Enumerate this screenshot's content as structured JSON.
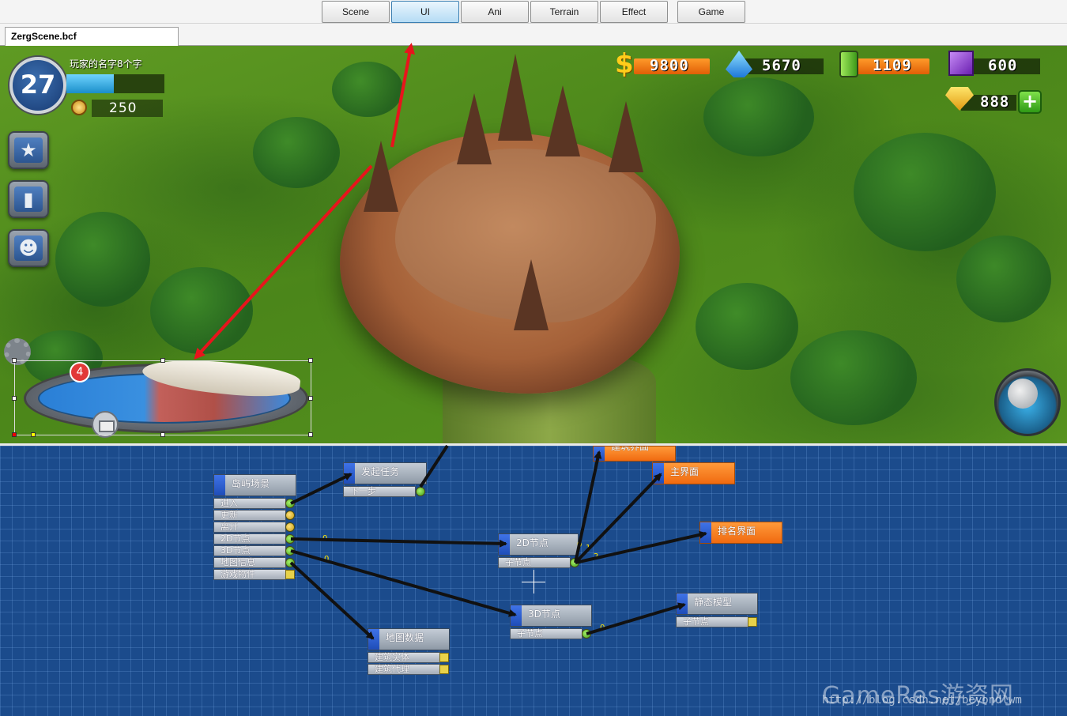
{
  "mode_tabs": [
    {
      "label": "Scene",
      "active": false
    },
    {
      "label": "UI",
      "active": true
    },
    {
      "label": "Ani",
      "active": false
    },
    {
      "label": "Terrain",
      "active": false
    },
    {
      "label": "Effect",
      "active": false
    },
    {
      "label": "Game",
      "active": false
    }
  ],
  "document_tab": {
    "label": "ZergScene.bcf"
  },
  "hud": {
    "level": "27",
    "player_name": "玩家的名字8个字",
    "xp_progress": 0.48,
    "medal_value": "250",
    "resources": {
      "gold": "9800",
      "crystal": "5670",
      "energy": "1109",
      "cube": "600",
      "gem": "888"
    },
    "plus_label": "+",
    "badge_count": "4"
  },
  "editor": {
    "nodes": {
      "island_scene": {
        "title": "岛屿场景",
        "ports": [
          "进入",
          "更新",
          "离开",
          "2D节点",
          "3D节点",
          "地图信息",
          "游戏物件"
        ]
      },
      "start_task": {
        "title": "发起任务",
        "ports": [
          "下一步"
        ]
      },
      "build_ui": {
        "title": "建筑界面"
      },
      "main_ui": {
        "title": "主界面"
      },
      "rank_ui": {
        "title": "排名界面"
      },
      "node_2d": {
        "title": "2D节点",
        "ports": [
          "子节点"
        ]
      },
      "node_3d": {
        "title": "3D节点",
        "ports": [
          "子节点"
        ]
      },
      "static_model": {
        "title": "静态模型",
        "ports": [
          "子节点"
        ]
      },
      "map_data": {
        "title": "地图数据",
        "ports": [
          "建筑实体",
          "建筑代理"
        ]
      }
    },
    "wire_labels": [
      "0",
      "0",
      "0",
      "1",
      "2",
      "0"
    ]
  },
  "watermark": {
    "brand": "GameRes游资网",
    "url": "http://blog.csdn.net/beyondlwm"
  },
  "colors": {
    "accent_tab": "#b5dcf5",
    "grid_bg": "#1b4b8c",
    "orange_node": "#f06a10",
    "arrow": "#e8141c"
  }
}
